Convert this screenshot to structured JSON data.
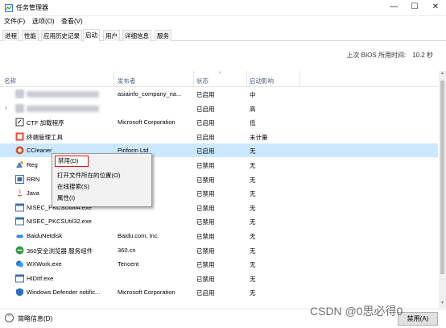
{
  "window": {
    "title": "任务管理器",
    "controls": {
      "minimize": "—",
      "maximize": "☐",
      "close": "✕"
    }
  },
  "menu": [
    "文件(F)",
    "选项(O)",
    "查看(V)"
  ],
  "tabs": [
    {
      "label": "进程",
      "active": false
    },
    {
      "label": "性能",
      "active": false
    },
    {
      "label": "应用历史记录",
      "active": false
    },
    {
      "label": "启动",
      "active": true
    },
    {
      "label": "用户",
      "active": false
    },
    {
      "label": "详细信息",
      "active": false
    },
    {
      "label": "服务",
      "active": false
    }
  ],
  "bios": {
    "label": "上次 BIOS 所用时间:",
    "value": "10.2 秒"
  },
  "columns": {
    "name": "名称",
    "publisher": "发布者",
    "status": "状态",
    "impact": "启动影响"
  },
  "rows": [
    {
      "name": "",
      "publisher": "asiainfo_company_na...",
      "status": "已启用",
      "impact": "中",
      "icon": "blurred-icon",
      "expander": ""
    },
    {
      "name": "",
      "publisher": "",
      "status": "已启用",
      "impact": "高",
      "icon": "blurred-icon",
      "expander": "›"
    },
    {
      "name": "CTF 加载程序",
      "publisher": "Microsoft Corporation",
      "status": "已启用",
      "impact": "低",
      "icon": "ctf-icon",
      "expander": ""
    },
    {
      "name": "终端管理工具",
      "publisher": "",
      "status": "已启用",
      "impact": "未计量",
      "icon": "terminal-tool-icon",
      "expander": ""
    },
    {
      "name": "CCleaner",
      "publisher": "Piriform Ltd",
      "status": "已启用",
      "impact": "无",
      "icon": "ccleaner-icon",
      "expander": "",
      "selected": true
    },
    {
      "name": "Reg",
      "publisher": "",
      "status": "已禁用",
      "impact": "无",
      "icon": "reg-icon",
      "expander": ""
    },
    {
      "name": "RRN",
      "publisher": "",
      "status": "已禁用",
      "impact": "无",
      "icon": "rrn-icon",
      "expander": ""
    },
    {
      "name": "Java",
      "publisher": "orporation",
      "status": "已禁用",
      "impact": "无",
      "icon": "java-icon",
      "expander": ""
    },
    {
      "name": "NISEC_PKCSUtil64.exe",
      "publisher": "",
      "status": "已禁用",
      "impact": "无",
      "icon": "app-window-icon",
      "expander": ""
    },
    {
      "name": "NISEC_PKCSUtil32.exe",
      "publisher": "",
      "status": "已禁用",
      "impact": "无",
      "icon": "app-window-icon",
      "expander": ""
    },
    {
      "name": "BaiduNetdisk",
      "publisher": "Baidu.com, Inc.",
      "status": "已禁用",
      "impact": "无",
      "icon": "baidu-netdisk-icon",
      "expander": ""
    },
    {
      "name": "360安全浏览器 服务组件",
      "publisher": "360.cn",
      "status": "已禁用",
      "impact": "无",
      "icon": "360-browser-icon",
      "expander": ""
    },
    {
      "name": "WXWork.exe",
      "publisher": "Tencent",
      "status": "已禁用",
      "impact": "无",
      "icon": "wxwork-icon",
      "expander": ""
    },
    {
      "name": "HIDItf.exe",
      "publisher": "",
      "status": "已禁用",
      "impact": "无",
      "icon": "app-window-icon",
      "expander": ""
    },
    {
      "name": "Windows Defender notific...",
      "publisher": "Microsoft Corporation",
      "status": "已启用",
      "impact": "无",
      "icon": "defender-icon",
      "expander": ""
    }
  ],
  "context_menu": {
    "disable": "禁用(D)",
    "open_location": "打开文件所在的位置(O)",
    "search_online": "在线搜索(S)",
    "properties": "属性(I)"
  },
  "footer": {
    "brief": "简略信息(D)",
    "button": "禁用(A)"
  },
  "watermark": "CSDN @0思必得0"
}
